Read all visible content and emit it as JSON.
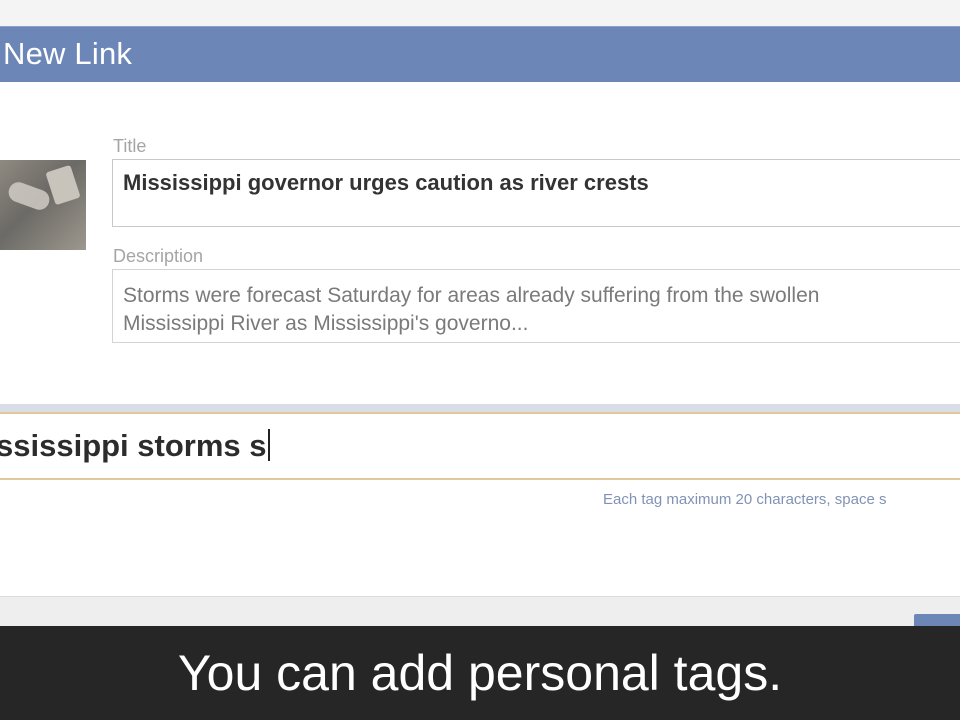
{
  "dialog": {
    "title": "New Link"
  },
  "form": {
    "title_label": "Title",
    "title_value": "Mississippi governor urges caution as river crests",
    "description_label": "Description",
    "description_value": "Storms were forecast Saturday for areas already suffering from the swollen\nMississippi River as Mississippi's governo...",
    "tags_value": "ssissippi storms s",
    "tags_hint": "Each tag maximum 20 characters, space s"
  },
  "caption": {
    "text": "You can add personal tags."
  },
  "colors": {
    "header": "#6d86b8",
    "tag_border": "#e2c79a",
    "hint": "#8193b5"
  }
}
